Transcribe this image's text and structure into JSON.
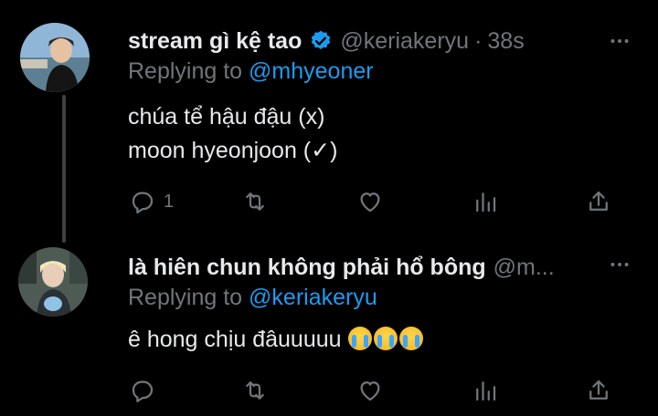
{
  "colors": {
    "background": "#000000",
    "text": "#e7e9ea",
    "muted": "#71767b",
    "accent": "#1d9bf0",
    "thread_line": "#3d4145"
  },
  "tweets": [
    {
      "display_name": "stream gì kệ tao",
      "verified": true,
      "handle": "@keriakeryu",
      "separator": "·",
      "time": "38s",
      "replying_label": "Replying to",
      "replying_to": "@mhyeoner",
      "lines": [
        "chúa tể hậu đậu (x)",
        "moon hyeonjoon (✓)"
      ],
      "reply_count": "1",
      "icons": [
        "reply-icon",
        "retweet-icon",
        "like-icon",
        "views-icon",
        "share-icon"
      ]
    },
    {
      "display_name": "là hiên chun không phải hổ bông",
      "handle": "@m...",
      "replying_label": "Replying to",
      "replying_to": "@keriakeryu",
      "lines": [
        "ê hong chịu đâuuuuu"
      ],
      "emoji": [
        "loudly-crying-face-emoji",
        "loudly-crying-face-emoji",
        "loudly-crying-face-emoji"
      ],
      "icons": [
        "reply-icon",
        "retweet-icon",
        "like-icon",
        "views-icon",
        "share-icon"
      ]
    }
  ]
}
